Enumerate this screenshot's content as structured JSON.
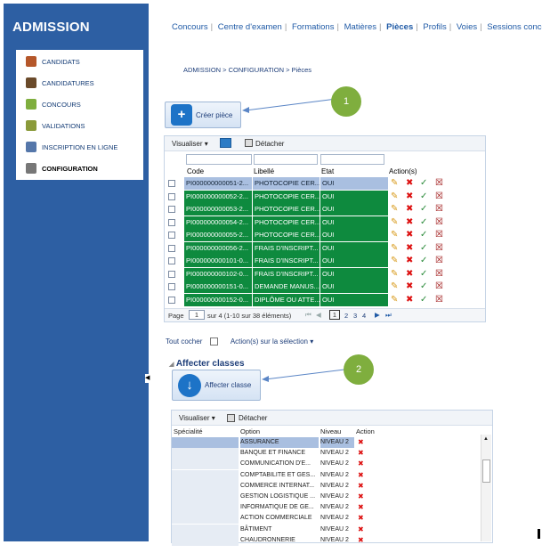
{
  "sidebar": {
    "title": "ADMISSION",
    "items": [
      {
        "label": "CANDIDATS",
        "icon": "candidates-icon",
        "color": "#b5572a"
      },
      {
        "label": "CANDIDATURES",
        "icon": "applications-icon",
        "color": "#6a4a2a"
      },
      {
        "label": "CONCOURS",
        "icon": "contest-icon",
        "color": "#7fae3e"
      },
      {
        "label": "VALIDATIONS",
        "icon": "validation-icon",
        "color": "#8a9a3a"
      },
      {
        "label": "INSCRIPTION EN LIGNE",
        "icon": "online-registration-icon",
        "color": "#5577aa"
      },
      {
        "label": "CONFIGURATION",
        "icon": "tools-icon",
        "color": "#777777"
      }
    ],
    "collapse": "◀"
  },
  "topnav": [
    "Concours",
    "Centre d'examen",
    "Formations",
    "Matières",
    "Pièces",
    "Profils",
    "Voies",
    "Sessions concours"
  ],
  "topnav_active": "Pièces",
  "breadcrumb": "ADMISSION > CONFIGURATION > Pièces",
  "create_button": "Créer pièce",
  "callout1": "1",
  "callout2": "2",
  "grid": {
    "toolbar": {
      "view": "Visualiser ▾",
      "detach": "Détacher"
    },
    "headers": [
      "Code",
      "Libellé",
      "Etat",
      "Action(s)"
    ],
    "rows": [
      {
        "code": "PI000000000051-2...",
        "label": "PHOTOCOPIE CER...",
        "state": "OUI"
      },
      {
        "code": "PI000000000052-2...",
        "label": "PHOTOCOPIE CER...",
        "state": "OUI"
      },
      {
        "code": "PI000000000053-2...",
        "label": "PHOTOCOPIE CER...",
        "state": "OUI"
      },
      {
        "code": "PI000000000054-2...",
        "label": "PHOTOCOPIE CER...",
        "state": "OUI"
      },
      {
        "code": "PI000000000055-2...",
        "label": "PHOTOCOPIE CER...",
        "state": "OUI"
      },
      {
        "code": "PI000000000056-2...",
        "label": "FRAIS D'INSCRIPT...",
        "state": "OUI"
      },
      {
        "code": "PI000000000101-0...",
        "label": "FRAIS D'INSCRIPT...",
        "state": "OUI"
      },
      {
        "code": "PI000000000102-0...",
        "label": "FRAIS D'INSCRIPT...",
        "state": "OUI"
      },
      {
        "code": "PI000000000151-0...",
        "label": "DEMANDE MANUS...",
        "state": "OUI"
      },
      {
        "code": "PI000000000152-0...",
        "label": "DIPLÔME OU ATTE...",
        "state": "OUI"
      }
    ],
    "pager": {
      "prefix": "Page",
      "page": "1",
      "suffix": "sur 4 (1-10 sur 38 éléments)",
      "pages": [
        "1",
        "2",
        "3",
        "4"
      ],
      "current": "1"
    }
  },
  "select_all": "Tout cocher",
  "bulk_action": "Action(s) sur la sélection ▾",
  "section_title": "Affecter classes",
  "assign_button": "Affecter classe",
  "grid2": {
    "toolbar": {
      "view": "Visualiser ▾",
      "detach": "Détacher"
    },
    "headers": [
      "Spécialité",
      "Option",
      "Niveau",
      "Action"
    ],
    "rows": [
      {
        "option": "ASSURANCE",
        "level": "NIVEAU 2"
      },
      {
        "option": "BANQUE ET FINANCE",
        "level": "NIVEAU 2"
      },
      {
        "option": "COMMUNICATION D'E...",
        "level": "NIVEAU 2"
      },
      {
        "option": "COMPTABILITE ET GES...",
        "level": "NIVEAU 2"
      },
      {
        "option": "COMMERCE INTERNAT...",
        "level": "NIVEAU 2"
      },
      {
        "option": "GESTION LOGISTIQUE ...",
        "level": "NIVEAU 2"
      },
      {
        "option": "INFORMATIQUE DE GE...",
        "level": "NIVEAU 2"
      },
      {
        "option": "ACTION COMMERCIALE",
        "level": "NIVEAU 2"
      },
      {
        "option": "BÂTIMENT",
        "level": "NIVEAU 2"
      },
      {
        "option": "CHAUDRONNERIE",
        "level": "NIVEAU 2"
      }
    ]
  },
  "colors": {
    "sidebar": "#2d5fa3",
    "row_green": "#0e8a3e",
    "selected_row": "#a9bfe0",
    "callout": "#7fae3e"
  }
}
